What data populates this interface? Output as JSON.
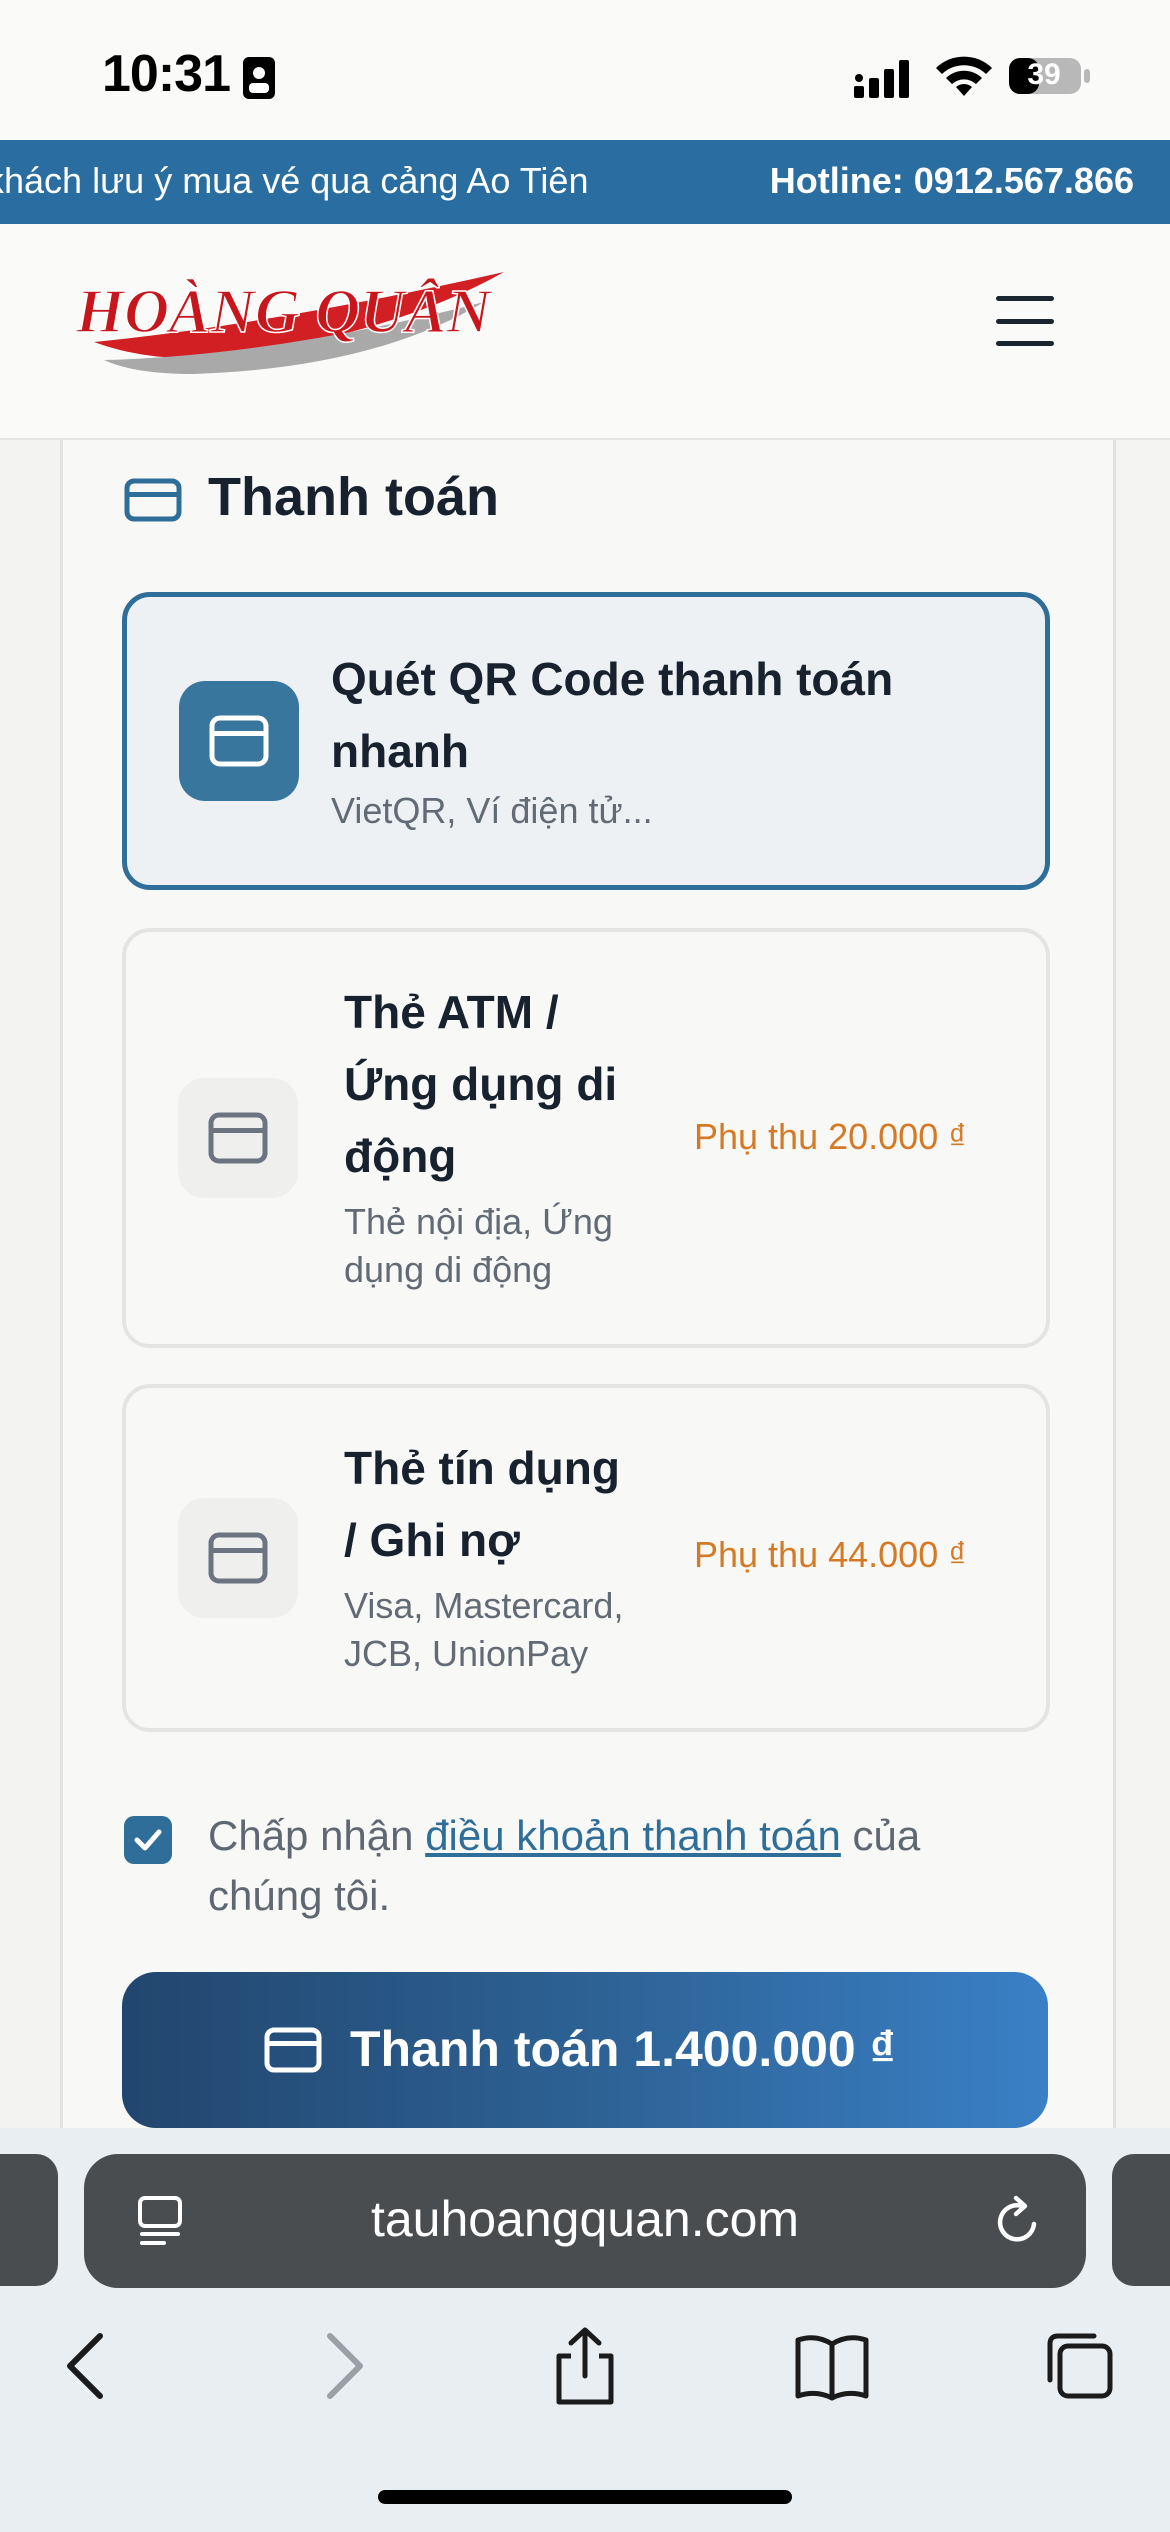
{
  "status_bar": {
    "time": "10:31",
    "battery": "39",
    "icons": [
      "id-card-icon",
      "cellular-signal-icon",
      "wifi-icon",
      "battery-icon"
    ]
  },
  "announcement": {
    "marquee": "khách lưu ý mua vé qua cảng Ao Tiên",
    "hotline": "Hotline: 0912.567.866"
  },
  "header": {
    "logo_text": "HOÀNG QUÂN",
    "menu_icon": "hamburger-menu-icon"
  },
  "payment": {
    "title": "Thanh toán",
    "options": [
      {
        "title": "Quét QR Code thanh toán nhanh",
        "subtitle": "VietQR, Ví điện tử...",
        "fee": "",
        "selected": true
      },
      {
        "title_lines": [
          "Thẻ ATM /",
          "Ứng dụng di",
          "động"
        ],
        "subtitle_lines": [
          "Thẻ nội địa, Ứng",
          "dụng di động"
        ],
        "fee": "Phụ thu 20.000 ₫",
        "selected": false
      },
      {
        "title_lines": [
          "Thẻ tín dụng",
          "/ Ghi nợ"
        ],
        "subtitle_lines": [
          "Visa, Mastercard,",
          "JCB, UnionPay"
        ],
        "fee": "Phụ thu 44.000 ₫",
        "selected": false
      }
    ],
    "terms": {
      "checked": true,
      "before": "Chấp nhận ",
      "link": "điều khoản thanh toán",
      "after": " của chúng tôi."
    },
    "pay_button": "Thanh toán 1.400.000 ₫"
  },
  "browser": {
    "url": "tauhoangquan.com",
    "toolbar_icons": [
      "back-icon",
      "forward-icon",
      "share-icon",
      "bookmarks-icon",
      "tabs-icon"
    ]
  },
  "colors": {
    "accent": "#2f6e99",
    "announcement_bar": "#2a6da0",
    "fee": "#d47a26",
    "logo_red": "#d11f24"
  }
}
